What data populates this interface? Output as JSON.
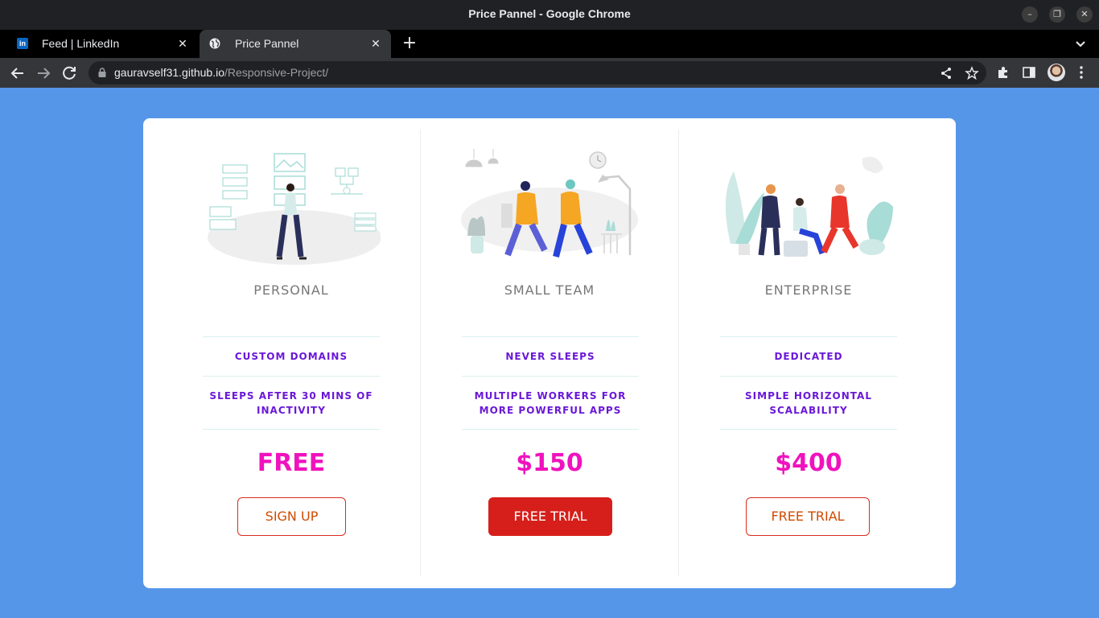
{
  "window": {
    "title": "Price Pannel - Google Chrome"
  },
  "tabs": [
    {
      "label": "Feed | LinkedIn",
      "icon": "linkedin-icon"
    },
    {
      "label": "Price Pannel",
      "icon": "globe-icon"
    }
  ],
  "address": {
    "host": "gauravself31.github.io",
    "path": "/Responsive-Project/"
  },
  "colors": {
    "page_background": "#5596e9",
    "feature_text": "#6a18d8",
    "price_text": "#f012be",
    "button_red": "#d61f1a"
  },
  "plans": [
    {
      "name": "PERSONAL",
      "illustration": "person-with-dashboard-illustration",
      "features": [
        "CUSTOM DOMAINS",
        "SLEEPS AFTER 30 MINS OF INACTIVITY"
      ],
      "price": "FREE",
      "button": {
        "label": "SIGN UP",
        "style": "outline"
      }
    },
    {
      "name": "SMALL TEAM",
      "illustration": "two-people-walking-illustration",
      "features": [
        "NEVER SLEEPS",
        "MULTIPLE WORKERS FOR MORE POWERFUL APPS"
      ],
      "price": "$150",
      "button": {
        "label": "FREE TRIAL",
        "style": "filled"
      }
    },
    {
      "name": "ENTERPRISE",
      "illustration": "team-meeting-illustration",
      "features": [
        "DEDICATED",
        "SIMPLE HORIZONTAL SCALABILITY"
      ],
      "price": "$400",
      "button": {
        "label": "FREE TRIAL",
        "style": "outline"
      }
    }
  ]
}
